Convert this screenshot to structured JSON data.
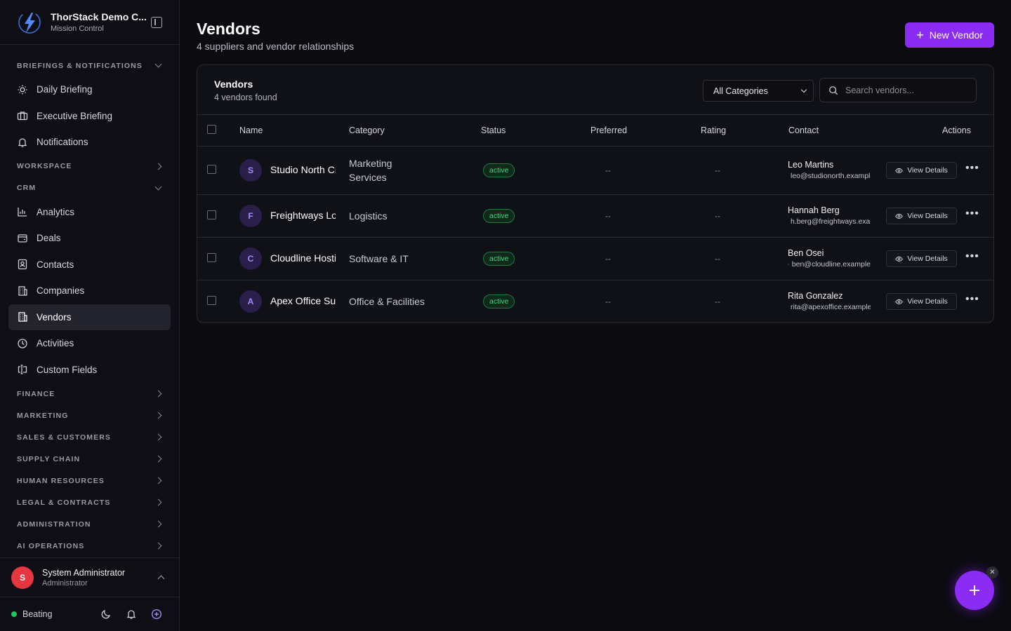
{
  "brand": {
    "title": "ThorStack Demo C...",
    "subtitle": "Mission Control"
  },
  "sidebar": {
    "sections": [
      {
        "label": "BRIEFINGS & NOTIFICATIONS"
      },
      {
        "label": "WORKSPACE"
      },
      {
        "label": "CRM"
      },
      {
        "label": "FINANCE"
      },
      {
        "label": "MARKETING"
      },
      {
        "label": "SALES & CUSTOMERS"
      },
      {
        "label": "SUPPLY CHAIN"
      },
      {
        "label": "HUMAN RESOURCES"
      },
      {
        "label": "LEGAL & CONTRACTS"
      },
      {
        "label": "ADMINISTRATION"
      },
      {
        "label": "AI OPERATIONS"
      }
    ],
    "items": {
      "daily_briefing": "Daily Briefing",
      "executive_briefing": "Executive Briefing",
      "notifications": "Notifications",
      "analytics": "Analytics",
      "deals": "Deals",
      "contacts": "Contacts",
      "companies": "Companies",
      "vendors": "Vendors",
      "activities": "Activities",
      "custom_fields": "Custom Fields"
    }
  },
  "user": {
    "initial": "S",
    "name": "System Administrator",
    "role": "Administrator"
  },
  "footer": {
    "status": "Beating",
    "status_color": "#22c55e"
  },
  "page": {
    "title": "Vendors",
    "subtitle": "4 suppliers and vendor relationships",
    "new_button": "New Vendor",
    "accent": "#8b2cf5"
  },
  "card": {
    "title": "Vendors",
    "subtitle": "4 vendors found",
    "filter_value": "All Categories",
    "search_placeholder": "Search vendors..."
  },
  "table": {
    "headers": {
      "name": "Name",
      "category": "Category",
      "status": "Status",
      "preferred": "Preferred",
      "rating": "Rating",
      "contact": "Contact",
      "actions": "Actions"
    },
    "rows": [
      {
        "initial": "S",
        "name": "Studio North Creative",
        "category": "Marketing Services",
        "status": "active",
        "preferred": "--",
        "rating": "--",
        "contact_name": "Leo Martins",
        "contact_email": "leo@studionorth.example",
        "action": "View Details"
      },
      {
        "initial": "F",
        "name": "Freightways Logistics",
        "category": "Logistics",
        "status": "active",
        "preferred": "--",
        "rating": "--",
        "contact_name": "Hannah Berg",
        "contact_email": "h.berg@freightways.example",
        "action": "View Details"
      },
      {
        "initial": "C",
        "name": "Cloudline Hosting",
        "category": "Software & IT",
        "status": "active",
        "preferred": "--",
        "rating": "--",
        "contact_name": "Ben Osei",
        "contact_email": "ben@cloudline.example",
        "action": "View Details"
      },
      {
        "initial": "A",
        "name": "Apex Office Supplies",
        "category": "Office & Facilities",
        "status": "active",
        "preferred": "--",
        "rating": "--",
        "contact_name": "Rita Gonzalez",
        "contact_email": "rita@apexoffice.example",
        "action": "View Details"
      }
    ]
  }
}
